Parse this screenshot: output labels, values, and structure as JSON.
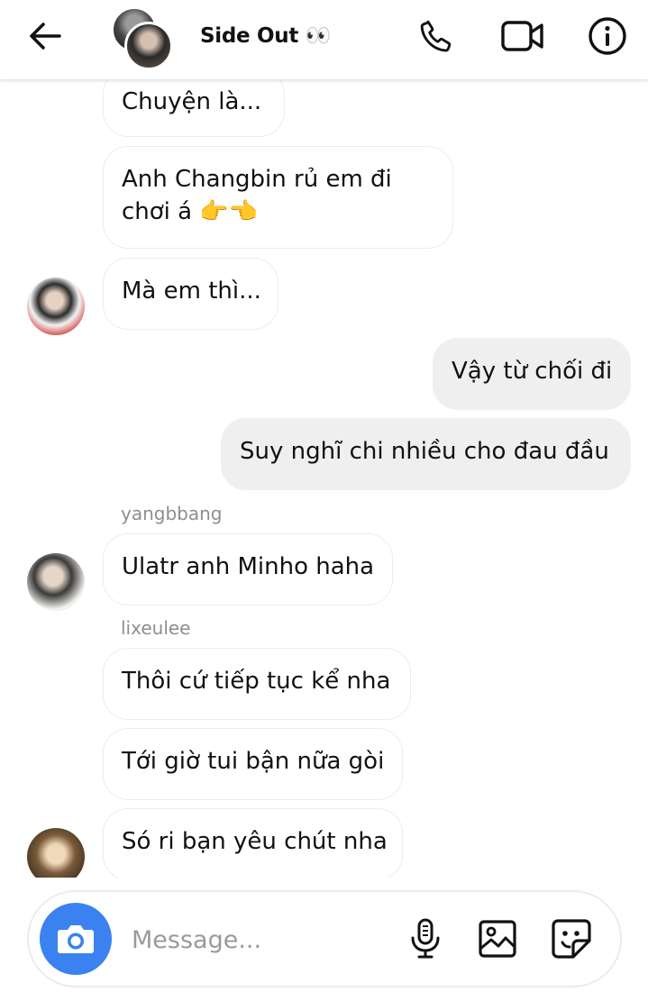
{
  "header": {
    "back_icon": "arrow-left-icon",
    "title": "Side Out 👀",
    "phone_icon": "phone-icon",
    "video_icon": "video-camera-icon",
    "info_icon": "info-icon"
  },
  "messages": [
    {
      "text": "Chuyện là..."
    },
    {
      "line1": "Anh Changbin rủ em đi",
      "line2": "chơi á 👉👈"
    },
    {
      "text": "Mà em thì..."
    },
    {
      "text": "Vậy từ chối đi"
    },
    {
      "text": "Suy nghĩ chi nhiều cho đau đầu"
    },
    {
      "sender": "yangbbang",
      "text": "Ulatr anh Minho haha"
    },
    {
      "sender": "lixeulee",
      "text": "Thôi cứ tiếp tục kể nha"
    },
    {
      "text": "Tới giờ tui bận nữa gòi"
    },
    {
      "text": "Só ri bạn yêu chút nha"
    }
  ],
  "composer": {
    "placeholder": "Message...",
    "camera_icon": "camera-icon",
    "mic_icon": "microphone-icon",
    "gallery_icon": "image-icon",
    "sticker_icon": "sticker-icon",
    "accent_color": "#3b82f0"
  }
}
